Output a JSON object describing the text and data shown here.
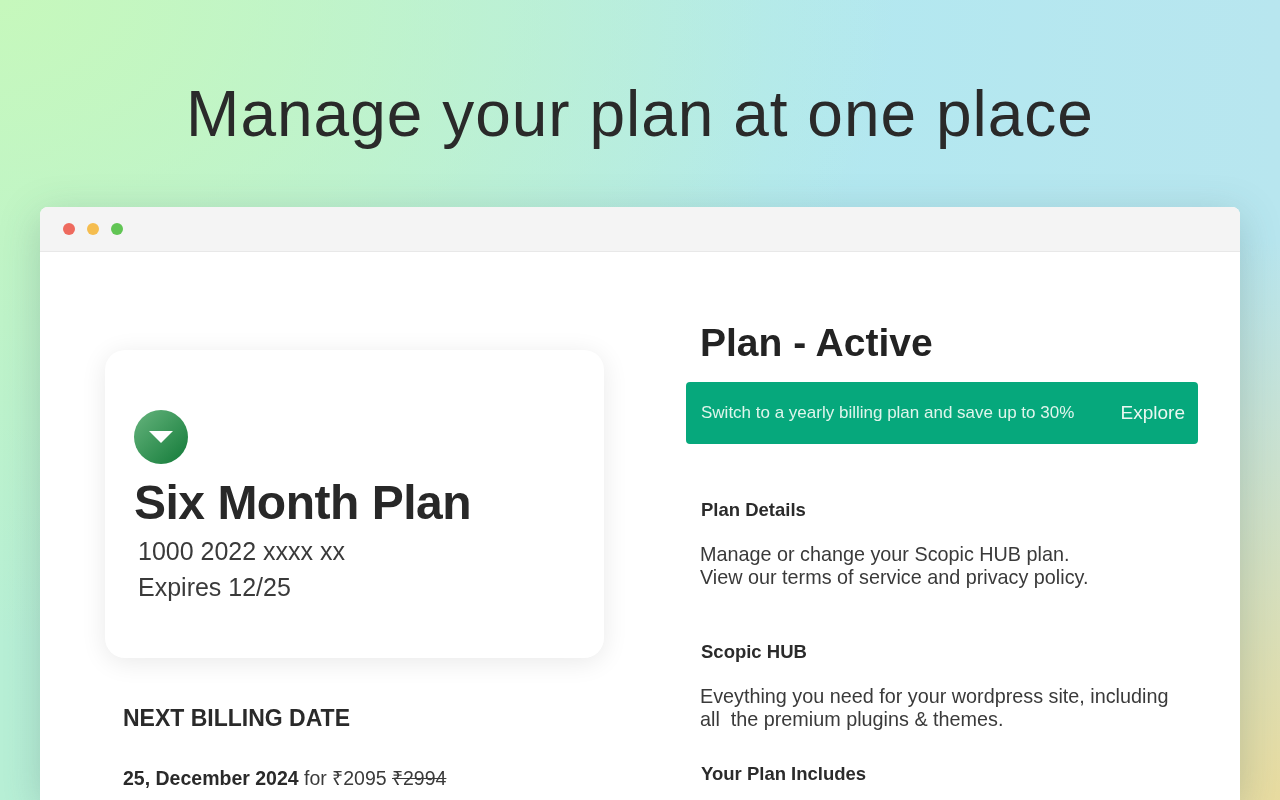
{
  "headline": "Manage your plan at one place",
  "plan_card": {
    "title": "Six Month Plan",
    "card_number": "1000 2022 xxxx xx",
    "expiry": "Expires 12/25"
  },
  "next_billing": {
    "heading": "NEXT BILLING DATE",
    "date": "25, December 2024",
    "connector": "for",
    "price": "₹2095",
    "old_price": "₹2994"
  },
  "plan_status": {
    "title": "Plan - Active"
  },
  "promo": {
    "text": "Switch to a yearly billing plan and save up to 30%",
    "action": "Explore"
  },
  "sections": [
    {
      "heading": "Plan Details",
      "lines": [
        "Manage or change your Scopic HUB plan.",
        "View our terms of service and privacy policy."
      ]
    },
    {
      "heading": "Scopic HUB",
      "lines": [
        "Eveything you need for your wordpress site, including",
        "all  the premium plugins & themes."
      ]
    },
    {
      "heading": "Your Plan Includes"
    }
  ]
}
